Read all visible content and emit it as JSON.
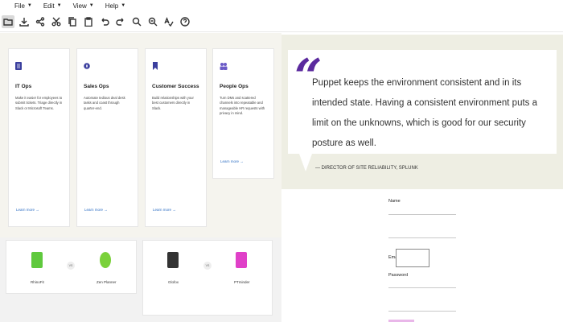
{
  "menubar": {
    "items": [
      {
        "label": "File"
      },
      {
        "label": "Edit"
      },
      {
        "label": "View"
      },
      {
        "label": "Help"
      }
    ]
  },
  "toolbar": {
    "icons": [
      "folder-icon",
      "download-icon",
      "share-icon",
      "cut-icon",
      "copy-icon",
      "paste-icon",
      "undo-icon",
      "redo-icon",
      "zoom-in-icon",
      "zoom-out-icon",
      "spellcheck-icon",
      "help-icon"
    ]
  },
  "cards": [
    {
      "title": "IT Ops",
      "desc": "Make it easier for employees to submit tickets. Triage directly in Slack or Microsoft Teams.",
      "learn": "Learn more →",
      "icon_color": "#3b3f9e"
    },
    {
      "title": "Sales Ops",
      "desc": "Automate tedious deal desk tasks and coast through quarter-end.",
      "learn": "Learn more →",
      "icon_color": "#3b3f9e"
    },
    {
      "title": "Customer Success",
      "desc": "Build relationships with your best customers directly in Slack.",
      "learn": "Learn more →",
      "icon_color": "#3b3f9e"
    },
    {
      "title": "People Ops",
      "desc": "Turn DMs and scattered channels into repeatable and manageable HR requests with privacy in mind.",
      "learn": "Learn more →",
      "icon_color": "#6a5ac7"
    }
  ],
  "integrations": [
    {
      "left": {
        "name": "RhinoFit",
        "color": "#5fc93d"
      },
      "vs": "VS",
      "right": {
        "name": "Zen Planner",
        "color": "#7ad13a"
      }
    },
    {
      "left": {
        "name": "Glofox",
        "color": "#333333"
      },
      "vs": "VS",
      "right": {
        "name": "PTminder",
        "color": "#e040c8"
      }
    }
  ],
  "quote": {
    "mark": "“",
    "text": "Puppet keeps the environment consistent and in its intended state. Having a consistent environment puts a limit on the unknowns, which is good for our security posture as well.",
    "attribution": "— DIRECTOR OF SITE RELIABILITY, SPLUNK",
    "accent": "#5b2a9e"
  },
  "form": {
    "name_label": "Name",
    "email_label": "Email",
    "password_label": "Password"
  }
}
